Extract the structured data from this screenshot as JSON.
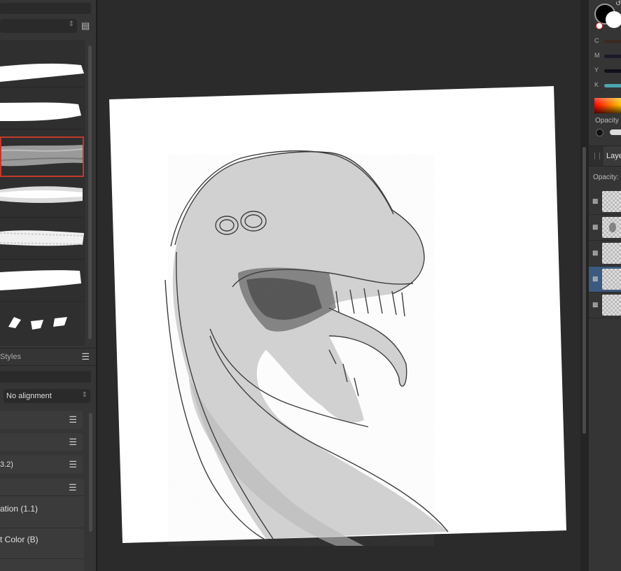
{
  "brushes_panel": {
    "category_select": "",
    "list_icon": "list-icon"
  },
  "styles_panel": {
    "tab_label": "Styles",
    "alignment": "No alignment",
    "rows": [
      {
        "label": ""
      },
      {
        "label": ""
      },
      {
        "label": "3.2)"
      },
      {
        "label": ""
      }
    ],
    "items": [
      {
        "label": "ation (1.1)"
      },
      {
        "label": "t Color (B)"
      }
    ]
  },
  "color_panel": {
    "channels": [
      {
        "label": "C",
        "color": "#3a2a22"
      },
      {
        "label": "M",
        "color": "#1a1a2a"
      },
      {
        "label": "Y",
        "color": "#10101a"
      },
      {
        "label": "K",
        "color": "#4aa6b0"
      }
    ],
    "opacity_label": "Opacity"
  },
  "layers_panel": {
    "tab_label": "Layers",
    "opacity_label": "Opacity:",
    "layers": [
      {
        "selected": false
      },
      {
        "selected": false
      },
      {
        "selected": false
      },
      {
        "selected": true
      },
      {
        "selected": false
      }
    ]
  },
  "colors": {
    "accent_selected_layer": "#3c5a80",
    "selected_brush_border": "#c0392b"
  }
}
